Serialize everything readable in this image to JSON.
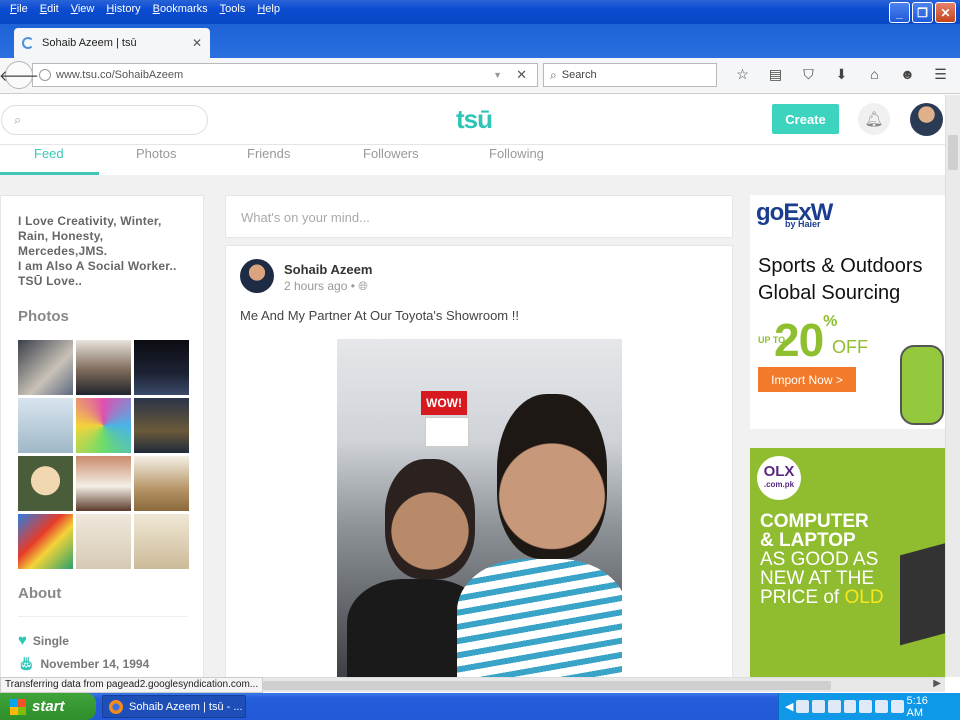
{
  "browser": {
    "menu": [
      "File",
      "Edit",
      "View",
      "History",
      "Bookmarks",
      "Tools",
      "Help"
    ],
    "tab_title": "Sohaib Azeem | tsū",
    "url": "www.tsu.co/SohaibAzeem",
    "search_placeholder": "Search",
    "status": "Transferring data from pagead2.googlesyndication.com..."
  },
  "site": {
    "logo": "tsū",
    "create_label": "Create",
    "nav": [
      "Feed",
      "Photos",
      "Friends",
      "Followers",
      "Following"
    ]
  },
  "profile": {
    "bio_lines": [
      "I Love Creativity, Winter,",
      "Rain, Honesty,",
      "Mercedes,JMS.",
      "I am Also A Social Worker..",
      "TSŪ Love.."
    ],
    "photos_heading": "Photos",
    "about_heading": "About",
    "relationship": "Single",
    "birthday": "November 14, 1994"
  },
  "composer": {
    "placeholder": "What's on your mind..."
  },
  "post": {
    "author": "Sohaib Azeem",
    "time": "2 hours ago •",
    "text": "Me And My Partner At Our Toyota's Showroom !!",
    "image_sign": "WOW!"
  },
  "ads": {
    "ad1": {
      "brand": "goExW",
      "brand_sub": "by Haier",
      "headline": "Sports & Outdoors Global Sourcing",
      "upto": "UP TO",
      "percent": "20",
      "pct_sign": "%",
      "off": "OFF",
      "button": "Import Now >"
    },
    "ad2": {
      "brand": "OLX",
      "brand_sub": ".com.pk",
      "line1": "COMPUTER",
      "line2": "& LAPTOP",
      "line3": "AS GOOD AS",
      "line4": "NEW AT THE",
      "line5": "PRICE of",
      "line5b": "OLD"
    }
  },
  "taskbar": {
    "start": "start",
    "window": "Sohaib Azeem | tsū - ...",
    "clock": "5:16 AM"
  },
  "colors": {
    "accent": "#3dc7b4",
    "xp_blue": "#245edb",
    "olx_green": "#8fbd2f"
  }
}
